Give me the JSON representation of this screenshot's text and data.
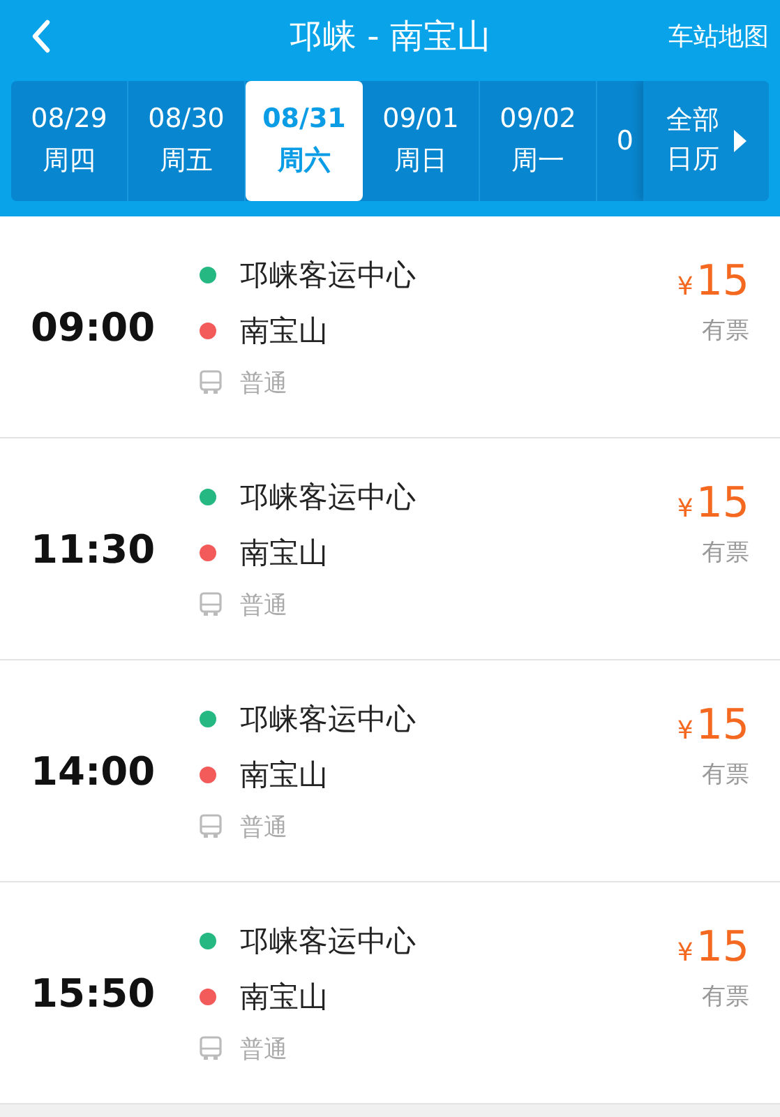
{
  "header": {
    "title": "邛崃 - 南宝山",
    "map_link": "车站地图"
  },
  "dates": [
    {
      "date": "08/29",
      "weekday": "周四",
      "selected": false
    },
    {
      "date": "08/30",
      "weekday": "周五",
      "selected": false
    },
    {
      "date": "08/31",
      "weekday": "周六",
      "selected": true
    },
    {
      "date": "09/01",
      "weekday": "周日",
      "selected": false
    },
    {
      "date": "09/02",
      "weekday": "周一",
      "selected": false
    },
    {
      "date": "0",
      "selected": false
    }
  ],
  "calendar_button": {
    "line1": "全部",
    "line2": "日历"
  },
  "trips": [
    {
      "time": "09:00",
      "stops": [
        {
          "name": "邛崃客运中心",
          "color": "#25b883"
        },
        {
          "name": "南宝山",
          "color": "#f35b5b"
        }
      ],
      "bus_type": "普通",
      "price": "15",
      "currency": "¥",
      "availability": "有票"
    },
    {
      "time": "11:30",
      "stops": [
        {
          "name": "邛崃客运中心",
          "color": "#25b883"
        },
        {
          "name": "南宝山",
          "color": "#f35b5b"
        }
      ],
      "bus_type": "普通",
      "price": "15",
      "currency": "¥",
      "availability": "有票"
    },
    {
      "time": "14:00",
      "stops": [
        {
          "name": "邛崃客运中心",
          "color": "#25b883"
        },
        {
          "name": "南宝山",
          "color": "#f35b5b"
        }
      ],
      "bus_type": "普通",
      "price": "15",
      "currency": "¥",
      "availability": "有票"
    },
    {
      "time": "15:50",
      "stops": [
        {
          "name": "邛崃客运中心",
          "color": "#25b883"
        },
        {
          "name": "南宝山",
          "color": "#f35b5b"
        }
      ],
      "bus_type": "普通",
      "price": "15",
      "currency": "¥",
      "availability": "有票"
    }
  ]
}
